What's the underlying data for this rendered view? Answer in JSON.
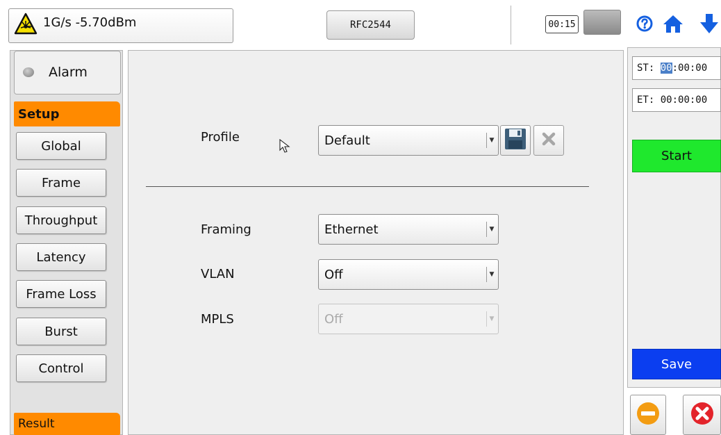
{
  "header": {
    "signal_status": "1G/s -5.70dBm",
    "test_mode": "RFC2544",
    "timer": "00:15"
  },
  "sidebar": {
    "alarm_label": "Alarm",
    "setup_header": "Setup",
    "items": [
      {
        "label": "Global"
      },
      {
        "label": "Frame"
      },
      {
        "label": "Throughput"
      },
      {
        "label": "Latency"
      },
      {
        "label": "Frame Loss"
      },
      {
        "label": "Burst"
      },
      {
        "label": "Control"
      }
    ],
    "result_header": "Result"
  },
  "main": {
    "profile": {
      "label": "Profile",
      "value": "Default"
    },
    "framing": {
      "label": "Framing",
      "value": "Ethernet"
    },
    "vlan": {
      "label": "VLAN",
      "value": "Off"
    },
    "mpls": {
      "label": "MPLS",
      "value": "Off"
    }
  },
  "right_panel": {
    "st_label": "ST:",
    "st_highlight": "00",
    "st_rest": ":00:00",
    "et_label": "ET:",
    "et_value": "00:00:00",
    "start_label": "Start",
    "save_label": "Save"
  },
  "colors": {
    "section_header": "#ff8a00",
    "start_button": "#1fe82d",
    "save_button": "#0b3ef0",
    "icon_blue": "#1560e0",
    "stop_icon": "#f39c12",
    "close_icon": "#e3242b"
  }
}
